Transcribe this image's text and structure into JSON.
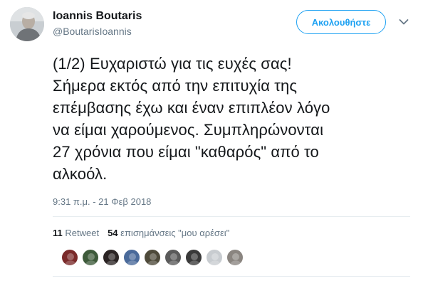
{
  "author": {
    "name": "Ioannis Boutaris",
    "handle": "@BoutarisIoannis"
  },
  "follow_button": {
    "label": "Ακολουθήστε"
  },
  "tweet": {
    "lines": [
      "(1/2) Ευχαριστώ για τις ευχές σας!",
      "Σήμερα εκτός από την επιτυχία της",
      "επέμβασης έχω και έναν επιπλέον λόγο",
      "να είμαι χαρούμενος. Συμπληρώνονται",
      "27 χρόνια που είμαι \"καθαρός\" από το",
      "αλκοόλ."
    ],
    "timestamp": "9:31 π.μ. - 21 Φεβ 2018"
  },
  "stats": {
    "retweets_count": "11",
    "retweets_label": "Retweet",
    "likes_count": "54",
    "likes_label": "επισημάνσεις \"μου αρέσει\""
  },
  "likers": [
    {
      "icon": "user-avatar",
      "color": "#7a2a2a"
    },
    {
      "icon": "user-avatar",
      "color": "#3d5a3a"
    },
    {
      "icon": "user-avatar",
      "color": "#2b2424"
    },
    {
      "icon": "user-avatar",
      "color": "#4a6a9a"
    },
    {
      "icon": "user-avatar",
      "color": "#4e4a3a"
    },
    {
      "icon": "user-avatar",
      "color": "#5a5a5a"
    },
    {
      "icon": "user-avatar",
      "color": "#3a3a3a"
    },
    {
      "icon": "user-avatar",
      "color": "#c8ccd0"
    },
    {
      "icon": "user-avatar",
      "color": "#8a8580"
    }
  ],
  "colors": {
    "accent": "#1da1f2",
    "muted": "#657786",
    "divider": "#e6ecf0"
  }
}
